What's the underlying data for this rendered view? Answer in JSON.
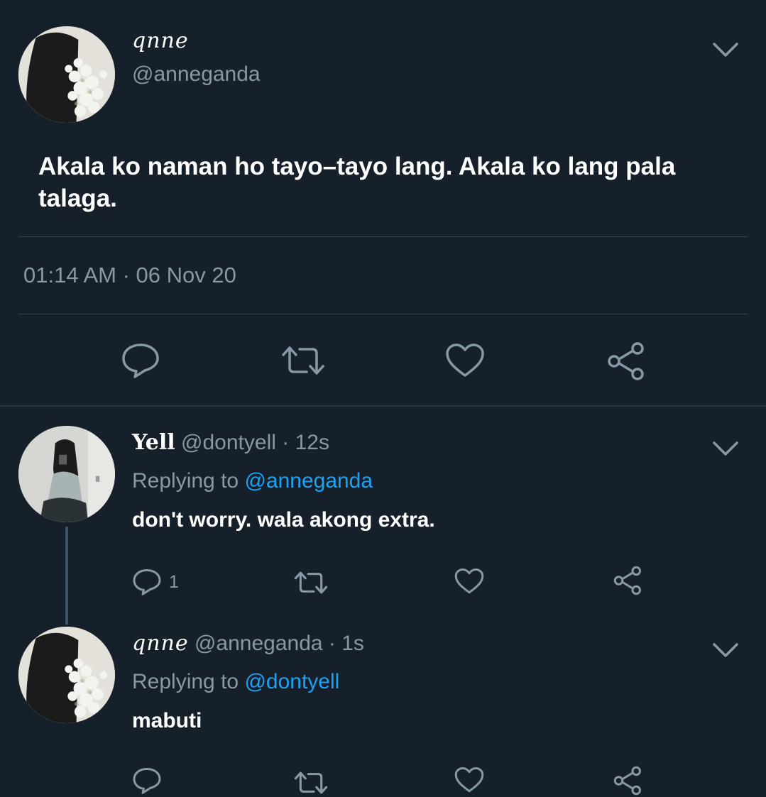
{
  "main_tweet": {
    "display_name": "qnne",
    "handle": "@anneganda",
    "text": "Akala ko naman ho tayo–tayo lang. Akala ko lang pala talaga.",
    "timestamp": "01:14 AM · 06 Nov 20"
  },
  "replies": [
    {
      "display_name": "Yell",
      "handle": "@dontyell",
      "time": "· 12s",
      "replying_label": "Replying to",
      "replying_to": "@anneganda",
      "text": "don't worry. wala akong extra.",
      "reply_count": "1"
    },
    {
      "display_name": "qnne",
      "handle": "@anneganda",
      "time": "· 1s",
      "replying_label": "Replying to",
      "replying_to": "@dontyell",
      "text": "mabuti",
      "reply_count": ""
    }
  ],
  "icons": {
    "reply": "reply-icon",
    "retweet": "retweet-icon",
    "like": "heart-icon",
    "share": "share-icon",
    "more": "chevron-down-icon"
  },
  "colors": {
    "background": "#15202b",
    "secondary_text": "#8899a6",
    "link": "#1da1f2",
    "divider": "#38444d"
  }
}
